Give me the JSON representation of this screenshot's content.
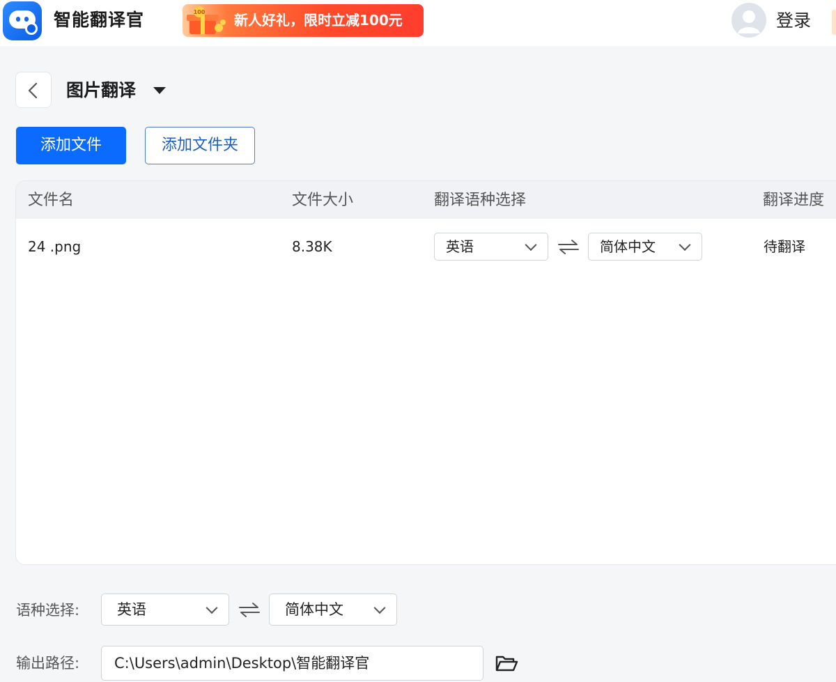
{
  "header": {
    "app_title": "智能翻译官",
    "logo_icon": "robot-logo-icon",
    "promo_text_prefix": "新人好礼，限时立减",
    "promo_amount": "100元",
    "promo_gift_badge": "100",
    "login_label": "登录"
  },
  "page": {
    "title": "图片翻译",
    "add_file_label": "添加文件",
    "add_folder_label": "添加文件夹"
  },
  "table": {
    "columns": [
      "文件名",
      "文件大小",
      "翻译语种选择",
      "翻译进度"
    ],
    "rows": [
      {
        "file_name": "24 .png",
        "file_size": "8.38K",
        "source_lang": "英语",
        "target_lang": "简体中文",
        "status": "待翻译"
      }
    ]
  },
  "bottom": {
    "lang_label": "语种选择:",
    "source_lang": "英语",
    "target_lang": "简体中文",
    "output_label": "输出路径:",
    "output_path": "C:\\Users\\admin\\Desktop\\智能翻译官"
  },
  "colors": {
    "primary": "#0c6bff",
    "promo": "#ff4a2a",
    "background": "#f5f6f8"
  }
}
